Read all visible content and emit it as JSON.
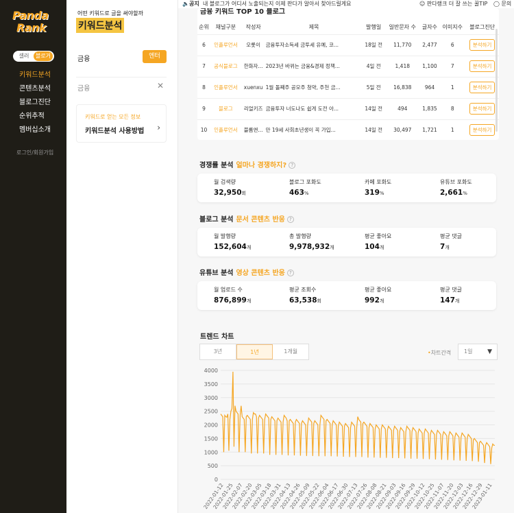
{
  "brand": {
    "logo_line1": "Panda",
    "logo_line2": "Rank",
    "accent": "#f5a623"
  },
  "rail": {
    "toggle_off": "셀러",
    "toggle_on": "블로거",
    "nav": [
      "키워드분석",
      "콘텐츠분석",
      "블로그진단",
      "순위추적",
      "멤버십소개"
    ],
    "login": "로그인/회원가입"
  },
  "panel": {
    "subtitle": "어떤 키워드로 글을 써야할까",
    "title": "키워드분석",
    "keyword": "금융",
    "enter": "엔터",
    "search_placeholder": "금융",
    "card_sub": "키워드로 얻는 모든 정보",
    "card_title": "키워드분석 사용방법"
  },
  "notice": {
    "label": "공지",
    "text": "내 블로그가 어디서 노출되는지 이제 판다가 알아서 찾아드릴게요",
    "tip": "판다랭크 더 잘 쓰는 꿀TIP",
    "qa": "문의하기"
  },
  "top10": {
    "title": "금융 키워드 TOP 10 블로그",
    "headers": [
      "순위",
      "채널구분",
      "작성자",
      "제목",
      "발행일",
      "일반문자 수",
      "글자수",
      "이미지수",
      "블로그진단"
    ],
    "button": "분석하기",
    "rows": [
      {
        "rank": "6",
        "channel": "인플루언서",
        "author": "오롯이",
        "title": "금융투자소득세 금투세 유예, 코...",
        "date": "18일 전",
        "chars": "11,770",
        "words": "2,477",
        "images": "6"
      },
      {
        "rank": "7",
        "channel": "공식블로그",
        "author": "한화자...",
        "title": "2023년 바뀌는 금융&경제 정책...",
        "date": "4일 전",
        "chars": "1,418",
        "words": "1,100",
        "images": "7"
      },
      {
        "rank": "8",
        "channel": "인플루언서",
        "author": "xuenxu",
        "title": "1월 돌째주 공모주 청약, 주천 금...",
        "date": "5일 전",
        "chars": "16,838",
        "words": "964",
        "images": "1"
      },
      {
        "rank": "9",
        "channel": "블로그",
        "author": "리얼키즈",
        "title": "금융투자 너도나도 쉽게 도전 아...",
        "date": "14일 전",
        "chars": "494",
        "words": "1,835",
        "images": "8"
      },
      {
        "rank": "10",
        "channel": "인플루언서",
        "author": "블롬앤...",
        "title": "만 19세 사회초년생이 꼭 가입...",
        "date": "14일 전",
        "chars": "30,497",
        "words": "1,721",
        "images": "1"
      }
    ]
  },
  "competition": {
    "title": "경쟁률 분석",
    "highlight": "얼마나 경쟁하지?",
    "stats": [
      {
        "label": "월 검색량",
        "value": "32,950",
        "unit": "회"
      },
      {
        "label": "블로그 포화도",
        "value": "463",
        "unit": "%"
      },
      {
        "label": "카페 포화도",
        "value": "319",
        "unit": "%"
      },
      {
        "label": "유튜브 포화도",
        "value": "2,661",
        "unit": "%"
      }
    ]
  },
  "blog": {
    "title": "블로그 분석",
    "highlight": "문서 콘텐츠 반응",
    "stats": [
      {
        "label": "월 발행량",
        "value": "152,604",
        "unit": "개"
      },
      {
        "label": "총 발행량",
        "value": "9,978,932",
        "unit": "개"
      },
      {
        "label": "평균 좋아요",
        "value": "104",
        "unit": "개"
      },
      {
        "label": "평균 댓글",
        "value": "7",
        "unit": "개"
      }
    ]
  },
  "youtube": {
    "title": "유튜브 분석",
    "highlight": "영상 콘텐츠 반응",
    "stats": [
      {
        "label": "월 업로드 수",
        "value": "876,899",
        "unit": "개"
      },
      {
        "label": "평균 조회수",
        "value": "63,538",
        "unit": "회"
      },
      {
        "label": "평균 좋아요",
        "value": "992",
        "unit": "개"
      },
      {
        "label": "평균 댓글",
        "value": "147",
        "unit": "개"
      }
    ]
  },
  "trend": {
    "title": "트렌드 차트",
    "ranges": [
      "3년",
      "1년",
      "1개월"
    ],
    "selected_range": "1년",
    "interval_label": "차트간격",
    "interval_value": "1일"
  },
  "chart_data": {
    "type": "line",
    "ylim": [
      0,
      4000
    ],
    "y_ticks": [
      0,
      500,
      1000,
      1500,
      2000,
      2500,
      3000,
      3500,
      4000
    ],
    "x_tick_labels": [
      "2022-01-12",
      "2022-01-25",
      "2022-02-07",
      "2022-02-20",
      "2022-03-05",
      "2022-03-18",
      "2022-03-31",
      "2022-04-13",
      "2022-04-26",
      "2022-05-09",
      "2022-05-22",
      "2022-06-04",
      "2022-06-17",
      "2022-06-30",
      "2022-07-13",
      "2022-07-26",
      "2022-08-08",
      "2022-08-21",
      "2022-09-03",
      "2022-09-16",
      "2022-09-29",
      "2022-10-12",
      "2022-10-25",
      "2022-11-07",
      "2022-11-20",
      "2022-12-03",
      "2022-12-16",
      "2022-12-29",
      "2023-01-11"
    ],
    "line_color": "#f5a623",
    "series": [
      {
        "values": [
          2400,
          2350,
          2300,
          1000,
          2350,
          2300,
          2280,
          2400,
          1050,
          2200,
          2500,
          2600,
          3950,
          1200,
          2700,
          2500,
          2450,
          2400,
          1000,
          2350,
          2700,
          2300,
          2250,
          2200,
          1000,
          2300,
          2350,
          2300,
          2250,
          2200,
          950,
          2200,
          2450,
          2400,
          2400,
          2300,
          950,
          2250,
          2350,
          2300,
          2250,
          2200,
          950,
          2200,
          2400,
          2350,
          2300,
          2250,
          900,
          2200,
          2300,
          2250,
          2200,
          2150,
          900,
          2150,
          2250,
          2200,
          2150,
          2100,
          900,
          2100,
          2350,
          2300,
          2250,
          2150,
          880,
          2150,
          2200,
          2150,
          2100,
          2050,
          880,
          2100,
          2200,
          2150,
          2100,
          2050,
          870,
          2050,
          2150,
          2100,
          2050,
          2000,
          860,
          2000,
          2250,
          2200,
          2150,
          2100,
          860,
          2050,
          2150,
          2100,
          2050,
          2000,
          850,
          2000,
          2350,
          2300,
          2250,
          2200,
          850,
          2150,
          2200,
          2150,
          2100,
          2050,
          850,
          2000,
          2150,
          2100,
          2050,
          2000,
          840,
          1950,
          2100,
          2050,
          2000,
          1950,
          830,
          1950,
          2050,
          2000,
          1950,
          1900,
          820,
          1900,
          2100,
          2050,
          2000,
          1950,
          820,
          1900,
          2300,
          2200,
          2150,
          2100,
          820,
          2050,
          2100,
          2050,
          2000,
          1950,
          800,
          1900,
          2050,
          2000,
          1950,
          1900,
          800,
          1850,
          2000,
          1950,
          1900,
          1850,
          790,
          1850,
          2000,
          1950,
          1900,
          1850,
          790,
          1800,
          1950,
          1900,
          1850,
          1800,
          780,
          1800,
          1950,
          1900,
          1850,
          1800,
          780,
          1750,
          1900,
          1850,
          1800,
          1750,
          770,
          1750,
          1950,
          1900,
          1850,
          1800,
          760,
          1750,
          1900,
          1850,
          1800,
          1750,
          760,
          1700,
          1850,
          1800,
          1750,
          1700,
          750,
          1700,
          1850,
          1800,
          1750,
          1700,
          740,
          1650,
          1800,
          1750,
          1700,
          1650,
          730,
          1650,
          1800,
          1750,
          1700,
          1650,
          720,
          1600,
          1750,
          1700,
          1650,
          1600,
          710,
          1600,
          1750,
          1700,
          1650,
          1600,
          700,
          1550,
          1700,
          1650,
          1600,
          1550,
          690,
          1550,
          1700,
          1650,
          1600,
          1550,
          680,
          1500,
          1650,
          1600,
          1550,
          1500,
          670,
          1450,
          1500,
          1450,
          1400,
          1350,
          650,
          1350,
          1400,
          1350,
          1300,
          1250,
          600,
          1250,
          1350,
          1300,
          1250,
          1200,
          560,
          1150,
          1300,
          1250,
          1250
        ]
      }
    ]
  }
}
